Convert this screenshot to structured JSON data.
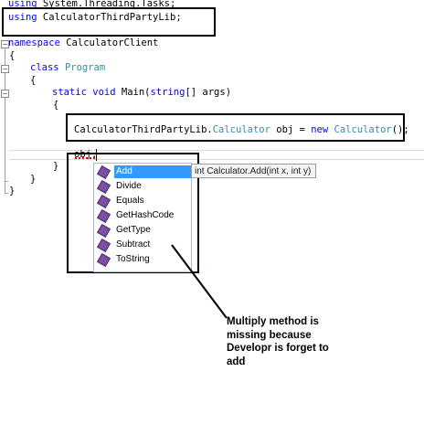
{
  "code": {
    "lines": [
      "using System.Threading.Tasks;",
      "using CalculatorThirdPartyLib;",
      "",
      "namespace CalculatorClient",
      "{",
      "class Program",
      "{",
      "static void Main(string[] args)",
      "{",
      "CalculatorThirdPartyLib.Calculator obj = new Calculator();",
      "obj.",
      "}",
      "}",
      "}"
    ],
    "tokens": {
      "using1_kw": "using",
      "using1_ns": " System.Threading.Tasks;",
      "using2_kw": "using",
      "using2_ns": " CalculatorThirdPartyLib;",
      "namespace_kw": "namespace",
      "namespace_name": " CalculatorClient",
      "class_kw": "class",
      "class_name": "Program",
      "static_kw": "static",
      "void_kw": "void",
      "main_sig": " Main(",
      "string_kw": "string",
      "args": "[] args)",
      "decl_ns": "CalculatorThirdPartyLib.",
      "decl_type": "Calculator",
      "decl_var": " obj = ",
      "new_kw": "new",
      "ctor_type": "Calculator",
      "decl_end": "();",
      "obj_typed": "obj."
    }
  },
  "intellisense": {
    "items": [
      "Add",
      "Divide",
      "Equals",
      "GetHashCode",
      "GetType",
      "Subtract",
      "ToString"
    ],
    "selected": "Add",
    "tooltip": "int Calculator.Add(int x, int y)",
    "item_icon": "method-icon"
  },
  "annotation": {
    "lines": [
      "Multiply method is",
      "missing because",
      "Developr is forget to",
      "add"
    ]
  },
  "colors": {
    "keyword": "#0000ff",
    "type": "#2b91af",
    "selection": "#3399ff"
  }
}
